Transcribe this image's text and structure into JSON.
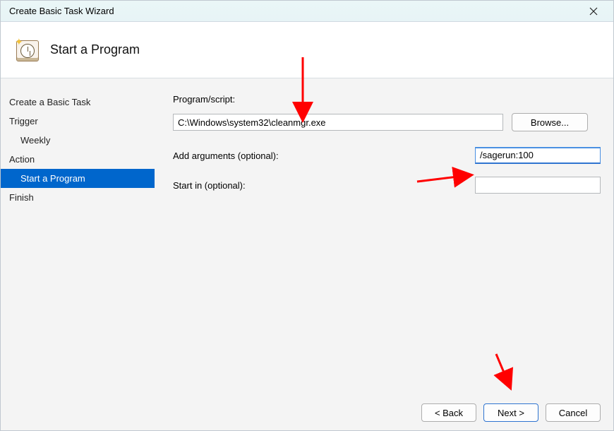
{
  "titlebar": {
    "title": "Create Basic Task Wizard"
  },
  "header": {
    "title": "Start a Program"
  },
  "sidebar": {
    "items": [
      {
        "label": "Create a Basic Task",
        "indent": false,
        "selected": false
      },
      {
        "label": "Trigger",
        "indent": false,
        "selected": false
      },
      {
        "label": "Weekly",
        "indent": true,
        "selected": false
      },
      {
        "label": "Action",
        "indent": false,
        "selected": false
      },
      {
        "label": "Start a Program",
        "indent": true,
        "selected": true
      },
      {
        "label": "Finish",
        "indent": false,
        "selected": false
      }
    ]
  },
  "form": {
    "program_label": "Program/script:",
    "program_value": "C:\\Windows\\system32\\cleanmgr.exe",
    "browse_label": "Browse...",
    "args_label": "Add arguments (optional):",
    "args_value": "/sagerun:100",
    "startin_label": "Start in (optional):",
    "startin_value": ""
  },
  "footer": {
    "back_label": "< Back",
    "next_label": "Next >",
    "cancel_label": "Cancel"
  },
  "annotations": {
    "arrow_color": "#ff0000"
  }
}
